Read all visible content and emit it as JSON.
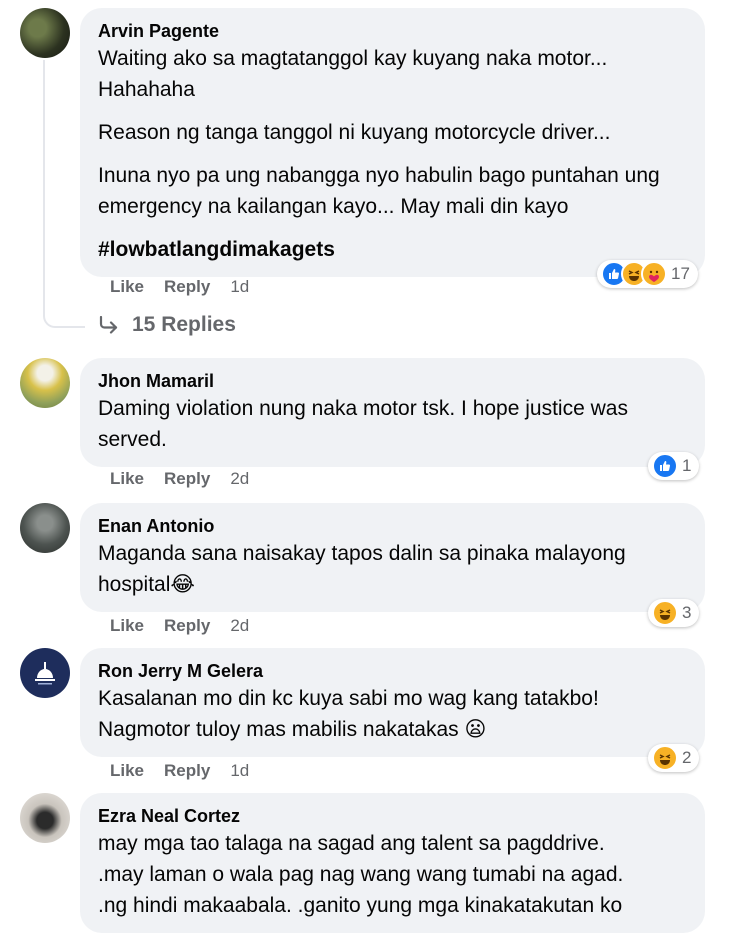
{
  "comments": [
    {
      "author": "Arvin Pagente",
      "paragraphs": [
        "Waiting ako sa magtatanggol kay kuyang naka motor... Hahahaha",
        "Reason ng tanga tanggol ni kuyang motorcycle driver...",
        "Inuna nyo pa ung nabangga nyo habulin bago puntahan ung emergency na kailangan kayo... May mali din kayo"
      ],
      "hashtag": "#lowbatlangdimakagets",
      "like": "Like",
      "reply": "Reply",
      "time": "1d",
      "reaction_count": "17",
      "reactions": [
        "like-icon",
        "haha-icon",
        "care-icon"
      ],
      "replies_label": "15 Replies"
    },
    {
      "author": "Jhon Mamaril",
      "text": "Daming violation nung naka motor tsk. I hope justice was served.",
      "like": "Like",
      "reply": "Reply",
      "time": "2d",
      "reaction_count": "1",
      "reactions": [
        "like-icon"
      ]
    },
    {
      "author": "Enan Antonio",
      "text": "Maganda sana naisakay tapos dalin sa pinaka malayong hospital😂",
      "like": "Like",
      "reply": "Reply",
      "time": "2d",
      "reaction_count": "3",
      "reactions": [
        "haha-icon"
      ]
    },
    {
      "author": "Ron Jerry M Gelera",
      "text": "Kasalanan mo din kc kuya sabi mo wag kang tatakbo! Nagmotor tuloy mas mabilis nakatakas 😦",
      "like": "Like",
      "reply": "Reply",
      "time": "1d",
      "reaction_count": "2",
      "reactions": [
        "haha-icon"
      ]
    },
    {
      "author": "Ezra Neal Cortez",
      "lines": [
        "may mga tao talaga na sagad ang talent sa pagddrive.",
        ".may laman o wala pag nag wang wang tumabi na agad.",
        ".ng hindi makaabala. .ganito yung mga kinakatakutan ko"
      ]
    }
  ],
  "colors": {
    "bubble": "#f0f2f5",
    "meta": "#65676b",
    "like_blue": "#1877f2",
    "haha_yellow": "#f7b125"
  }
}
